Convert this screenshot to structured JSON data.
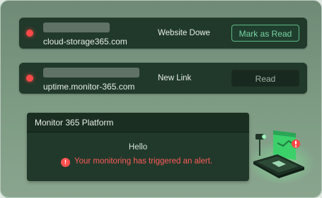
{
  "notifications": [
    {
      "domain": "cloud-storage365.com",
      "subject": "Website Dowe",
      "action_label": "Mark as Read"
    },
    {
      "domain": "uptime.monitor-365.com",
      "subject": "New Link",
      "action_label": "Read"
    }
  ],
  "preview": {
    "title": "Monitor 365 Platform",
    "greeting": "Hello",
    "alert_icon": "!",
    "alert_text": "Your monitoring  has triggered an alert."
  },
  "colors": {
    "accent": "#79d3a3",
    "status_dot": "#ff4a4a",
    "alert": "#ff5a5a",
    "row_bg": "#21392a"
  },
  "icons": [
    "status-dot-icon",
    "alert-icon",
    "laptop-alert-illustration"
  ]
}
